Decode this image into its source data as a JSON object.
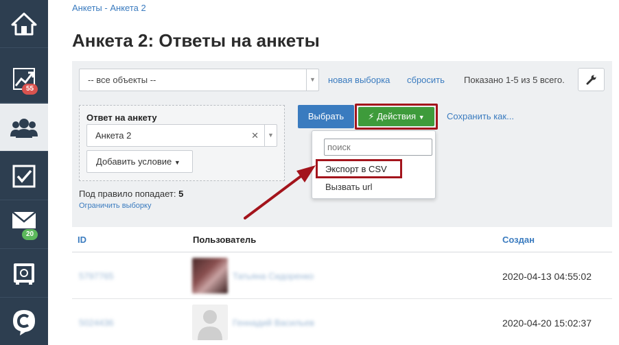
{
  "sidebar": {
    "items": [
      {
        "icon": "home-icon"
      },
      {
        "icon": "chart-icon",
        "badge": "55",
        "badge_color": "#d9534f"
      },
      {
        "icon": "users-icon",
        "active": true
      },
      {
        "icon": "checkbox-icon"
      },
      {
        "icon": "mail-icon",
        "badge": "20",
        "badge_color": "#5cb85c"
      },
      {
        "icon": "safe-icon"
      },
      {
        "icon": "logo-c-icon"
      }
    ]
  },
  "breadcrumb": {
    "item1": "Анкеты",
    "separator": " - ",
    "item2": "Анкета 2"
  },
  "page_title": "Анкета 2: Ответы на анкеты",
  "toolbar": {
    "object_select_value": "-- все объекты --",
    "new_selection": "новая выборка",
    "reset": "сбросить",
    "shown_text": "Показано 1-5 из 5 всего.",
    "choose_button": "Выбрать",
    "actions_button": "Действия",
    "save_as": "Сохранить как..."
  },
  "condition": {
    "label": "Ответ на анкету",
    "select_value": "Анкета 2",
    "add_condition": "Добавить условие",
    "rule_text": "Под правило попадает:",
    "rule_count": "5",
    "limit_link": "Ограничить выборку"
  },
  "dropdown": {
    "search_placeholder": "поиск",
    "export_csv": "Экспорт в CSV",
    "call_url": "Вызвать url"
  },
  "table": {
    "headers": {
      "id": "ID",
      "user": "Пользователь",
      "created": "Создан"
    },
    "rows": [
      {
        "id": "5797765",
        "user": "Татьяна Сидоренко",
        "created": "2020-04-13 04:55:02"
      },
      {
        "id": "5024436",
        "user": "Геннадий Васильев",
        "created": "2020-04-20 15:02:37"
      }
    ]
  },
  "colors": {
    "sidebar_bg": "#2d3e50",
    "link_blue": "#3a7bbf",
    "action_green": "#3e9b3b",
    "highlight_red": "#a3141c"
  }
}
